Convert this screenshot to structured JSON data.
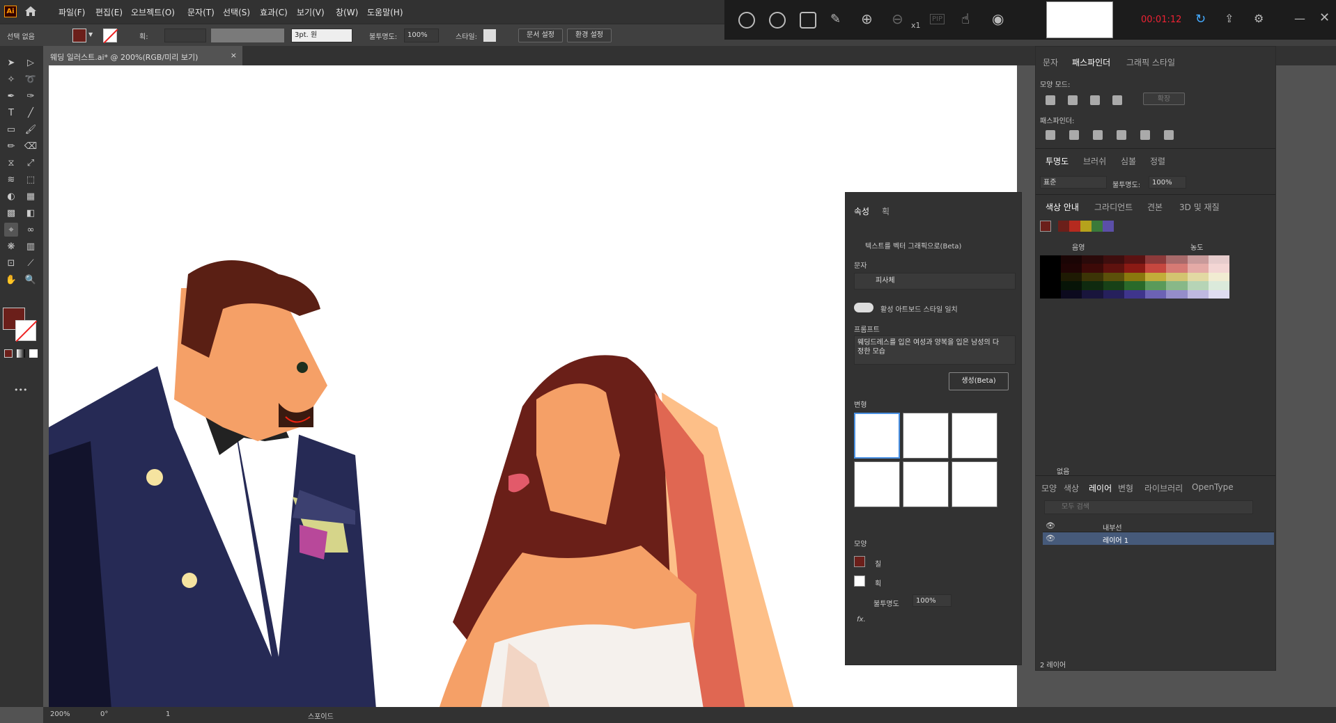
{
  "app": {
    "logo": "Ai"
  },
  "menu": [
    "파일(F)",
    "편집(E)",
    "오브젝트(O)",
    "문자(T)",
    "선택(S)",
    "효과(C)",
    "보기(V)",
    "창(W)",
    "도움말(H)"
  ],
  "control": {
    "selection": "선택 없음",
    "stroke_label": "획:",
    "stroke_style": "3pt. 원",
    "opacity_label": "불투명도:",
    "opacity": "100%",
    "style_label": "스타일:",
    "doc_setup": "문서 설정",
    "prefs": "환경 설정"
  },
  "recorder": {
    "zoom": "x1",
    "pip": "PIP",
    "timer": "00:01:12"
  },
  "document": {
    "tab": "웨딩 일러스트.ai* @ 200%(RGB/미리 보기)"
  },
  "status": {
    "zoom": "200%",
    "rotation": "0°",
    "artboard": "1",
    "tool": "스포이드"
  },
  "properties": {
    "tabs": [
      "속성",
      "획"
    ],
    "section": "텍스트를 벡터 그래픽으로(Beta)",
    "type_label": "문자",
    "type_value": "피사체",
    "match_style": "활성 아트보드 스타일 일치",
    "prompt_label": "프롬프트",
    "prompt": "웨딩드레스를 입은 여성과 양복을 입은 남성의 다정한 모습",
    "generate": "생성(Beta)",
    "variations_label": "변형",
    "appearance_label": "모양",
    "fill_label": "칠",
    "stroke_label": "획",
    "opacity_label": "불투명도",
    "opacity": "100%",
    "fx": "fx."
  },
  "pathfinder": {
    "tabs": [
      "문자",
      "패스파인더",
      "그래픽 스타일"
    ],
    "shape_modes": "모양 모드:",
    "expand": "확장",
    "pathfinders": "패스파인더:"
  },
  "transparency": {
    "tabs": [
      "투명도",
      "브러쉬",
      "심볼",
      "정렬"
    ],
    "mode": "표준",
    "opacity_label": "불투명도:",
    "opacity": "100%"
  },
  "colorguide": {
    "tabs": [
      "색상 안내",
      "그라디언트",
      "견본",
      "3D 및 재질"
    ],
    "shades": "음영",
    "tints": "농도",
    "footer": "없음",
    "harmony": [
      "#6b1f1a",
      "#b52a1f",
      "#b6a21c",
      "#3a7a3a",
      "#5b4fa8"
    ],
    "grid": [
      [
        "#000",
        "#1a0505",
        "#2a0a0a",
        "#3e0e0e",
        "#5a1212",
        "#8c3a3a",
        "#a86a6a",
        "#c89a9a",
        "#e6cccc"
      ],
      [
        "#000",
        "#200505",
        "#3d0a08",
        "#5e120e",
        "#8a1a14",
        "#c6473f",
        "#d67a74",
        "#e4aaa6",
        "#f3d6d4"
      ],
      [
        "#000",
        "#1e1a03",
        "#3c3406",
        "#5c500a",
        "#8a780e",
        "#c2ad3a",
        "#d3c470",
        "#e2d9a3",
        "#f1ecd2"
      ],
      [
        "#000",
        "#071407",
        "#0f2a0f",
        "#174117",
        "#2a6a2a",
        "#5a9a5a",
        "#88b888",
        "#b6d4b6",
        "#dbeadb"
      ],
      [
        "#000",
        "#0c0a1e",
        "#19153c",
        "#26205c",
        "#3f358c",
        "#6c62b4",
        "#958dca",
        "#bfb9e0",
        "#dfdcf0"
      ]
    ]
  },
  "layers": {
    "tabs": [
      "모양",
      "색상",
      "레이어",
      "변형",
      "라이브러리",
      "OpenType"
    ],
    "search": "모두 검색",
    "items": [
      "내부선",
      "레이어 1"
    ],
    "count": "2 레이어"
  }
}
